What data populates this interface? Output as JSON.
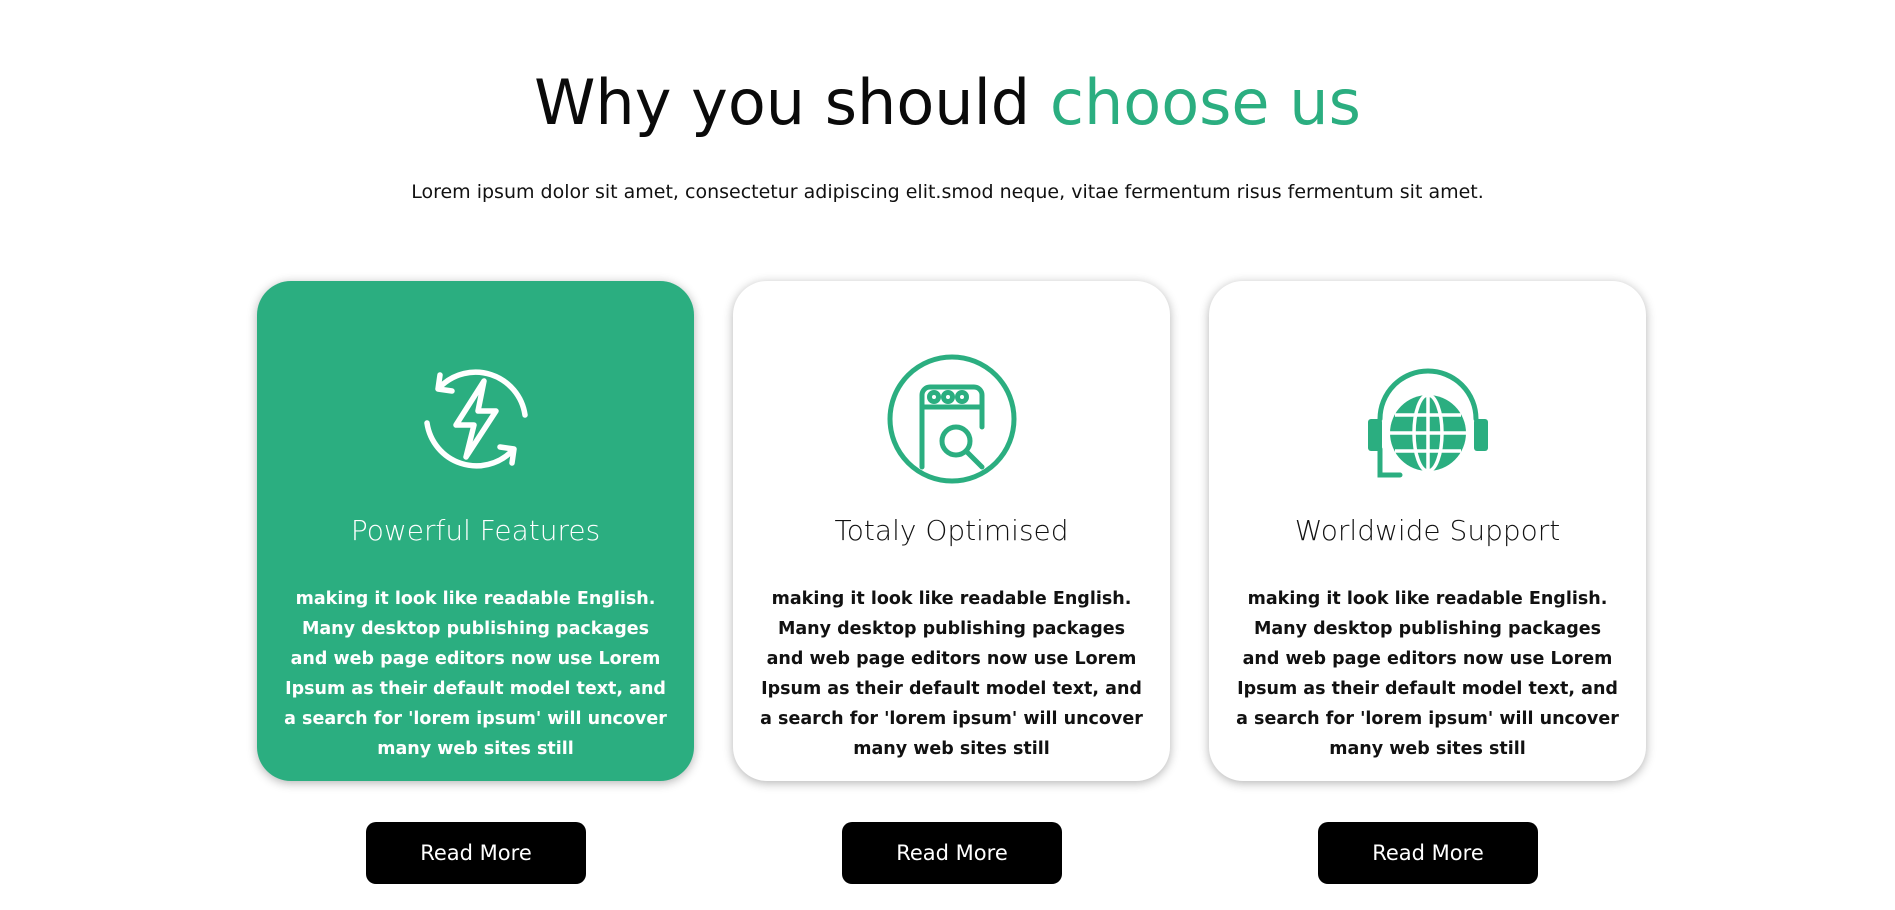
{
  "header": {
    "title_part1": "Why you should ",
    "title_part2": "choose us",
    "subtitle": "Lorem ipsum dolor sit amet, consectetur adipiscing elit.smod neque, vitae fermentum risus fermentum sit amet."
  },
  "colors": {
    "accent": "#2bae80",
    "text": "#111111",
    "button_bg": "#000000",
    "button_text": "#ffffff"
  },
  "cards": [
    {
      "icon": "lightning-refresh-icon",
      "title": "Powerful Features",
      "text": "making it look like readable English. Many desktop publishing packages and web page editors now use Lorem Ipsum as their default model text, and a search for 'lorem ipsum' will uncover many web sites still",
      "active": true,
      "button_label": "Read More"
    },
    {
      "icon": "browser-search-icon",
      "title": "Totaly Optimised",
      "text": "making it look like readable English. Many desktop publishing packages and web page editors now use Lorem Ipsum as their default model text, and a search for 'lorem ipsum' will uncover many web sites still",
      "active": false,
      "button_label": "Read More"
    },
    {
      "icon": "globe-headset-icon",
      "title": "Worldwide Support",
      "text": "making it look like readable English. Many desktop publishing packages and web page editors now use Lorem Ipsum as their default model text, and a search for 'lorem ipsum' will uncover many web sites still",
      "active": false,
      "button_label": "Read More"
    }
  ]
}
